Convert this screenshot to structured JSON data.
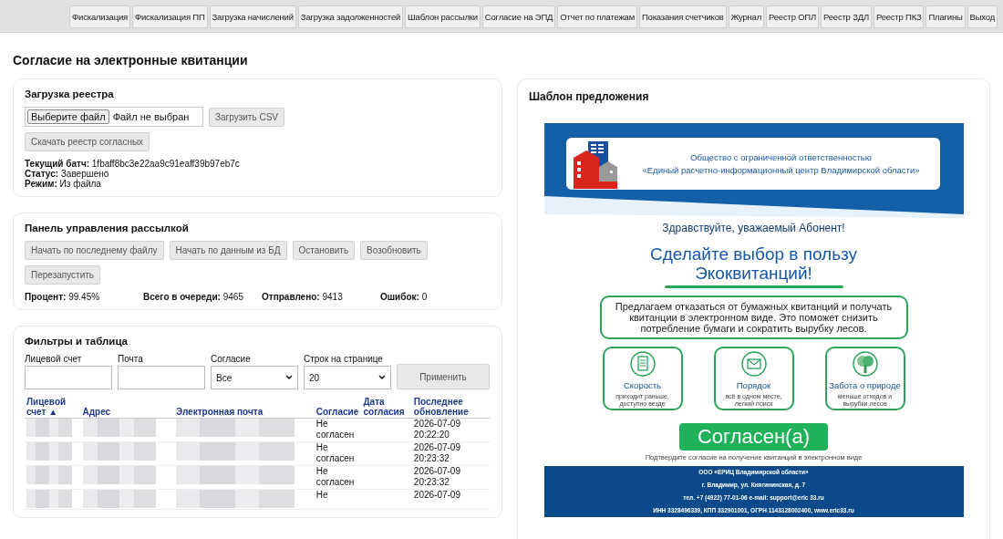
{
  "nav": [
    {
      "label": "Фискализация"
    },
    {
      "label": "Фискализация ПП"
    },
    {
      "label": "Загрузка начислений"
    },
    {
      "label": "Загрузка задолженностей"
    },
    {
      "label": "Шаблон рассылки"
    },
    {
      "label": "Согласие на ЭПД"
    },
    {
      "label": "Отчет по платежам"
    },
    {
      "label": "Показания счетчиков"
    },
    {
      "label": "Журнал"
    },
    {
      "label": "Реестр ОПЛ"
    },
    {
      "label": "Реестр ЗДЛ"
    },
    {
      "label": "Реестр ПКЗ"
    },
    {
      "label": "Плагины"
    },
    {
      "label": "Выход"
    }
  ],
  "page_title": "Согласие на электронные квитанции",
  "upload": {
    "title": "Загрузка реестра",
    "file_button": "Выберите файл",
    "file_status": "Файл не выбран",
    "upload_button": "Загрузить CSV",
    "download_button": "Скачать реестр согласных",
    "info": [
      {
        "label": "Текущий батч:",
        "value": "1fbaff8bc3e22aa9c91eaff39b97eb7c"
      },
      {
        "label": "Статус:",
        "value": "Завершено"
      },
      {
        "label": "Режим:",
        "value": "Из файла"
      }
    ]
  },
  "mailing": {
    "title": "Панель управления рассылкой",
    "buttons": [
      "Начать по последнему файлу",
      "Начать по данным из БД",
      "Остановить",
      "Возобновить",
      "Перезапустить"
    ],
    "stats": [
      {
        "label": "Процент:",
        "value": "99.45%"
      },
      {
        "label": "Всего в очереди:",
        "value": "9465"
      },
      {
        "label": "Отправлено:",
        "value": "9413"
      },
      {
        "label": "Ошибок:",
        "value": "0"
      }
    ]
  },
  "filters": {
    "title": "Фильтры и таблица",
    "fields": [
      {
        "label": "Лицевой счет",
        "kind": "input"
      },
      {
        "label": "Почта",
        "kind": "input"
      },
      {
        "label": "Согласие",
        "kind": "select",
        "value": "Все"
      },
      {
        "label": "Строк на странице",
        "kind": "select",
        "value": "20"
      }
    ],
    "apply_button": "Применить"
  },
  "table": {
    "columns": [
      "Лицевой счет ▲",
      "Адрес",
      "Электронная почта",
      "Согласие",
      "Дата согласия",
      "Последнее обновление"
    ],
    "rows": [
      {
        "consent": "Не согласен",
        "updated": "2026-07-09 20:22:20"
      },
      {
        "consent": "Не согласен",
        "updated": "2026-07-09 20:23:32"
      },
      {
        "consent": "Не согласен",
        "updated": "2026-07-09 20:23:32"
      },
      {
        "consent": "Не",
        "updated": "2026-07-09"
      }
    ]
  },
  "template": {
    "title": "Шаблон предложения",
    "org_line1": "Общество с ограниченной ответственностью",
    "org_line2": "«Единый расчетно-информационный центр Владимирской области»",
    "greeting": "Здравствуйте, уважаемый Абонент!",
    "headline": "Сделайте выбор в пользу Экоквитанций!",
    "offer": "Предлагаем отказаться от бумажных квитанций и получать квитанции в электронном виде. Это поможет снизить потребление бумаги и сократить вырубку лесов.",
    "benefits": [
      {
        "kind": "document",
        "title": "Скорость",
        "text": "приходит раньше, доступно везде"
      },
      {
        "kind": "envelope",
        "title": "Порядок",
        "text": "всё в одном месте, легкий поиск"
      },
      {
        "kind": "tree",
        "title": "Забота о природе",
        "text": "меньше отходов и вырубки лесов"
      }
    ],
    "agree_button": "Согласен(а)",
    "confirm_note": "Подтвердите согласие на получение квитанций в электронном виде",
    "footer": [
      "ООО «ЕРИЦ Владимирской области»",
      "г. Владимир, ул. Княгининская, д. 7",
      "тел. +7 (4922) 77-01-06 e-mail: support@eric 33.ru",
      "ИНН 3328496339, КПП 332901001, ОГРН 1143328002400, www.eric33.ru"
    ]
  }
}
